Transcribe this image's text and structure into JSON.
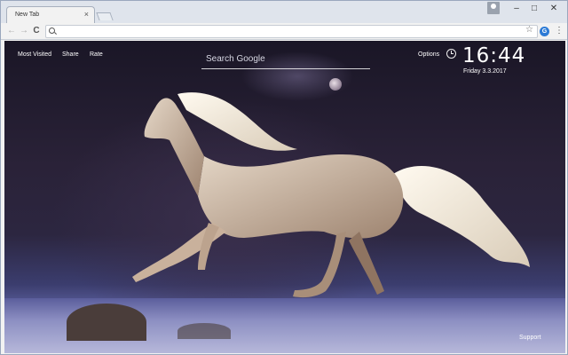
{
  "browser": {
    "tab_title": "New Tab",
    "tab_close": "×",
    "window_controls": {
      "minimize": "–",
      "maximize": "□",
      "close": "✕"
    },
    "address": {
      "value": "",
      "placeholder": ""
    },
    "nav": {
      "back": "←",
      "forward": "→",
      "reload": "C"
    },
    "menu": "⋮",
    "extension_badge": "G"
  },
  "newtab": {
    "links": [
      "Most Visited",
      "Share",
      "Rate"
    ],
    "search_placeholder": "Search Google",
    "options_label": "Options",
    "time": "16:44",
    "date": "Friday  3.3.2017",
    "support_label": "Support"
  },
  "icons": [
    "search-icon",
    "star-icon",
    "clock-icon",
    "profile-icon",
    "menu-icon"
  ],
  "colors": {
    "sky": "#1a1626",
    "snow": "#9a9cc6",
    "text": "#ffffff"
  }
}
